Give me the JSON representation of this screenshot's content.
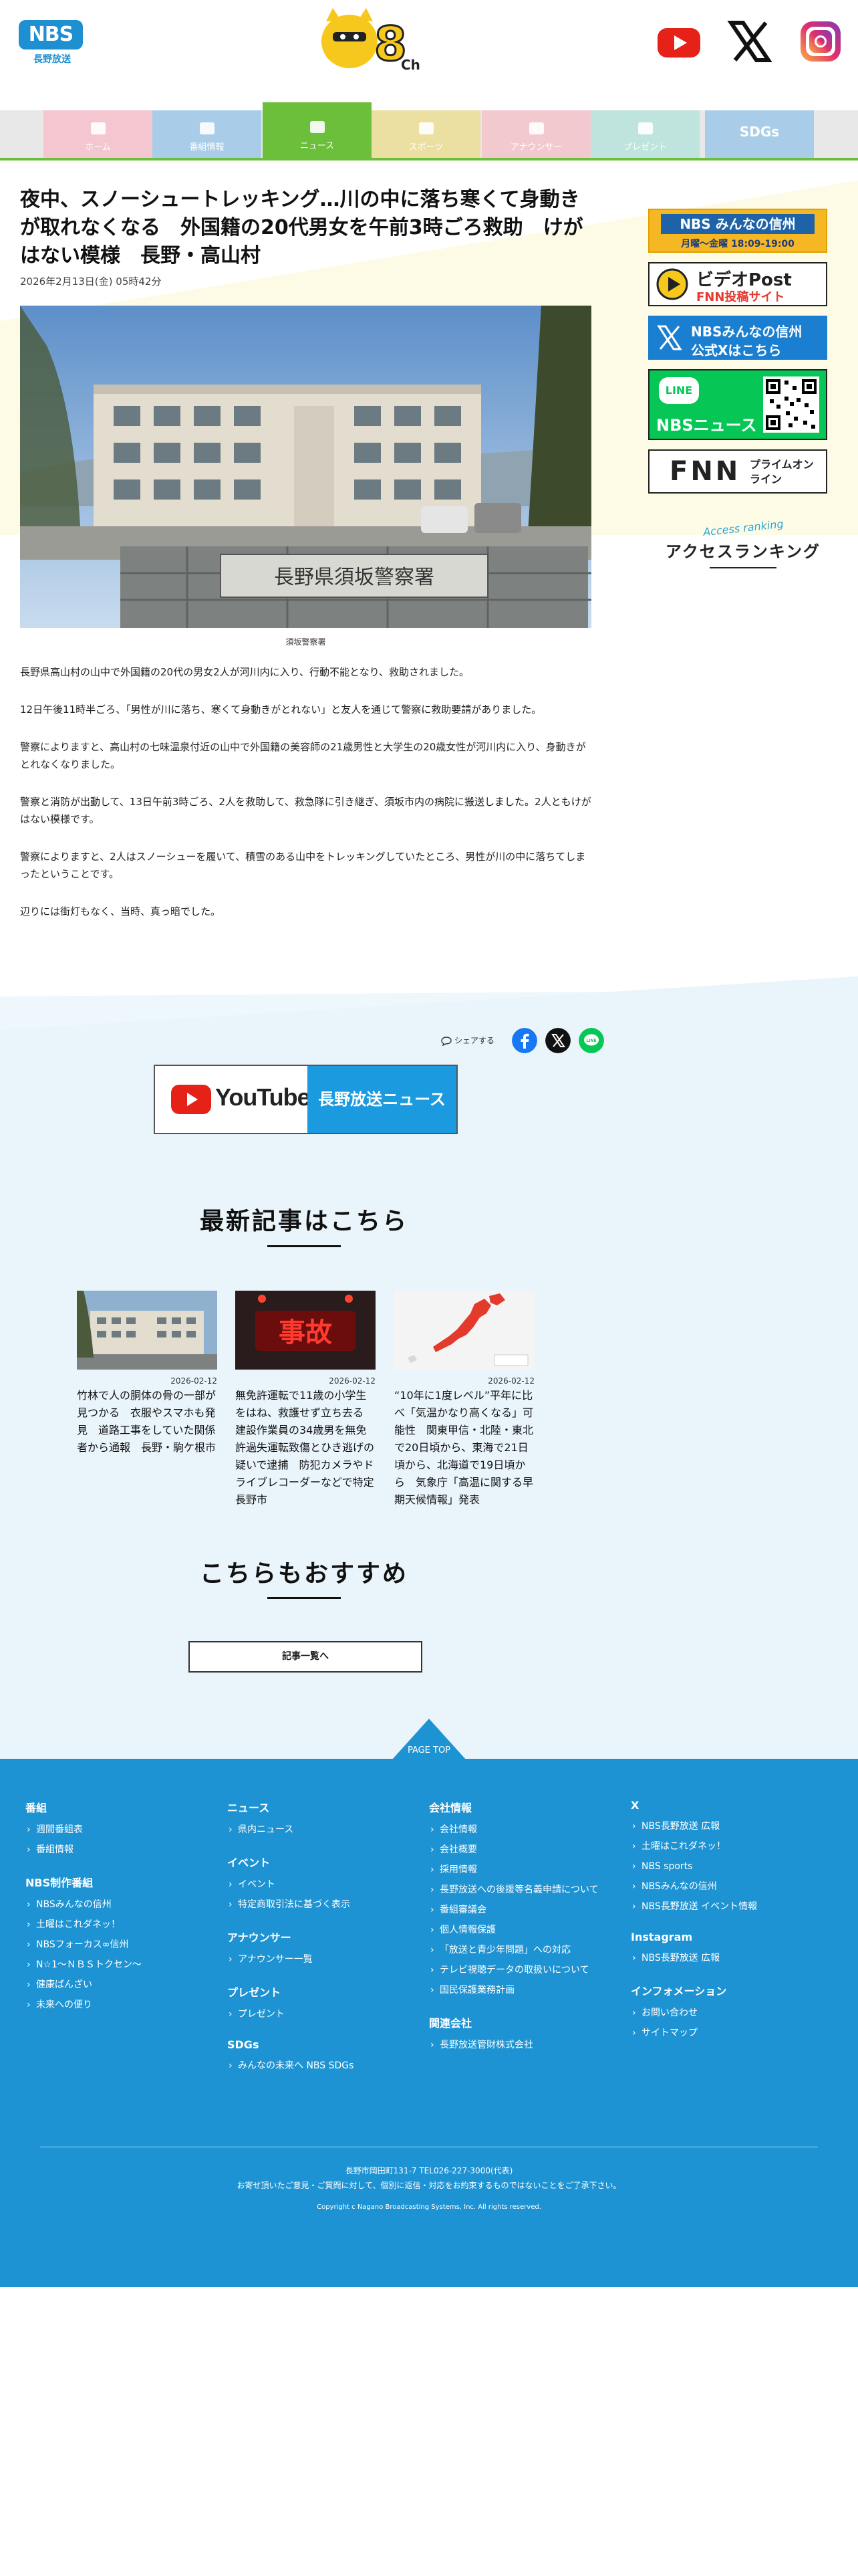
{
  "header": {
    "logo_text": "NBS",
    "logo_sub": "長野放送",
    "mascot_label": "8ch",
    "social": [
      "youtube-icon",
      "x-icon",
      "instagram-icon"
    ]
  },
  "nav": {
    "items": [
      {
        "label": "ホーム",
        "color": "#f4c6cf"
      },
      {
        "label": "番組情報",
        "color": "#a9cde8"
      },
      {
        "label": "ニュース",
        "color": "#6bbf3a"
      },
      {
        "label": "スポーツ",
        "color": "#ecdfa2"
      },
      {
        "label": "アナウンサー",
        "color": "#f2c9cf"
      },
      {
        "label": "プレゼント",
        "color": "#bfe4dd"
      },
      {
        "label": "SDGs",
        "color": "#a9cde8"
      }
    ]
  },
  "article": {
    "title": "夜中、スノーシュートレッキング…川の中に落ち寒くて身動きが取れなくなる　外国籍の20代男女を午前3時ごろ救助　けがはない模様　長野・高山村",
    "date": "2026年2月13日(金) 05時42分",
    "photo_sign": "長野県須坂警察署",
    "caption": "須坂警察署",
    "paragraphs": [
      "長野県高山村の山中で外国籍の20代の男女2人が河川内に入り、行動不能となり、救助されました。",
      "12日午後11時半ごろ、「男性が川に落ち、寒くて身動きがとれない」と友人を通じて警察に救助要請がありました。",
      "警察によりますと、高山村の七味温泉付近の山中で外国籍の美容師の21歳男性と大学生の20歳女性が河川内に入り、身動きがとれなくなりました。",
      "警察と消防が出動して、13日午前3時ごろ、2人を救助して、救急隊に引き継ぎ、須坂市内の病院に搬送しました。2人ともけがはない模様です。",
      "警察によりますと、2人はスノーシューを履いて、積雪のある山中をトレッキングしていたところ、男性が川の中に落ちてしまったということです。",
      "辺りには街灯もなく、当時、真っ暗でした。"
    ]
  },
  "sidebar": {
    "banners": [
      {
        "line1": "NBS みんなの信州",
        "line2": "月曜～金曜 18:09-19:00"
      },
      {
        "line1": "ビデオPost",
        "line2": "FNN投稿サイト"
      },
      {
        "line1": "NBSみんなの信州",
        "line2": "公式Xはこちら"
      },
      {
        "line1": "LINE",
        "line2": "NBSニュース"
      },
      {
        "line1": "FNN",
        "line2": "プライムオンライン"
      }
    ],
    "ranking_en": "Access ranking",
    "ranking_ja": "アクセスランキング"
  },
  "share": {
    "label": "シェアする"
  },
  "ytnews": {
    "yt": "YouTube",
    "label": "長野放送ニュース"
  },
  "latest": {
    "heading": "最新記事はこちら",
    "cards": [
      {
        "date": "2026-02-12",
        "title": "竹林で人の胴体の骨の一部が見つかる　衣服やスマホも発見　道路工事をしていた関係者から通報　長野・駒ケ根市"
      },
      {
        "date": "2026-02-12",
        "title": "無免許運転で11歳の小学生をはね、救護せず立ち去る　建設作業員の34歳男を無免許過失運転致傷とひき逃げの疑いで逮捕　防犯カメラやドライブレコーダーなどで特定　長野市"
      },
      {
        "date": "2026-02-12",
        "title": "“10年に1度レベル”平年に比べ「気温かなり高くなる」可能性　関東甲信・北陸・東北で20日頃から、東海で21日頃から、北海道で19日頃から　気象庁「高温に関する早期天候情報」発表"
      }
    ]
  },
  "recommend": {
    "heading": "こちらもおすすめ"
  },
  "more_button": "記事一覧へ",
  "pagetop": "PAGE TOP",
  "footer": {
    "col1": [
      {
        "h": "番組",
        "items": [
          "週間番組表",
          "番組情報"
        ]
      },
      {
        "h": "NBS制作番組",
        "items": [
          "NBSみんなの信州",
          "土曜はこれダネッ！",
          "NBSフォーカス∞信州",
          "N☆1～ＮＢＳトクセン～",
          "健康ばんざい",
          "未来への便り"
        ]
      }
    ],
    "col2": [
      {
        "h": "ニュース",
        "items": [
          "県内ニュース"
        ]
      },
      {
        "h": "イベント",
        "items": [
          "イベント",
          "特定商取引法に基づく表示"
        ]
      },
      {
        "h": "アナウンサー",
        "items": [
          "アナウンサー一覧"
        ]
      },
      {
        "h": "プレゼント",
        "items": [
          "プレゼント"
        ]
      },
      {
        "h": "SDGs",
        "items": [
          "みんなの未来へ NBS SDGs"
        ]
      }
    ],
    "col3": [
      {
        "h": "会社情報",
        "items": [
          "会社情報",
          "会社概要",
          "採用情報",
          "長野放送への後援等名義申請について",
          "番組審議会",
          "個人情報保護",
          "「放送と青少年問題」への対応",
          "テレビ視聴データの取扱いについて",
          "国民保護業務計画"
        ]
      },
      {
        "h": "関連会社",
        "items": [
          "長野放送管財株式会社"
        ]
      }
    ],
    "col4": [
      {
        "h": "X",
        "items": [
          "NBS長野放送 広報",
          "土曜はこれダネッ！",
          "NBS sports",
          "NBSみんなの信州",
          "NBS長野放送 イベント情報"
        ]
      },
      {
        "h": "Instagram",
        "items": [
          "NBS長野放送 広報"
        ]
      },
      {
        "h": "インフォメーション",
        "items": [
          "お問い合わせ",
          "サイトマップ"
        ]
      }
    ],
    "address": "長野市岡田町131-7 TEL026-227-3000(代表)",
    "notice": "お寄せ頂いたご意見・ご質問に対して、個別に返信・対応をお約束するものではないことをご了承下さい。",
    "copyright": "Copyright c Nagano Broadcasting Systems, Inc. All rights reserved."
  }
}
